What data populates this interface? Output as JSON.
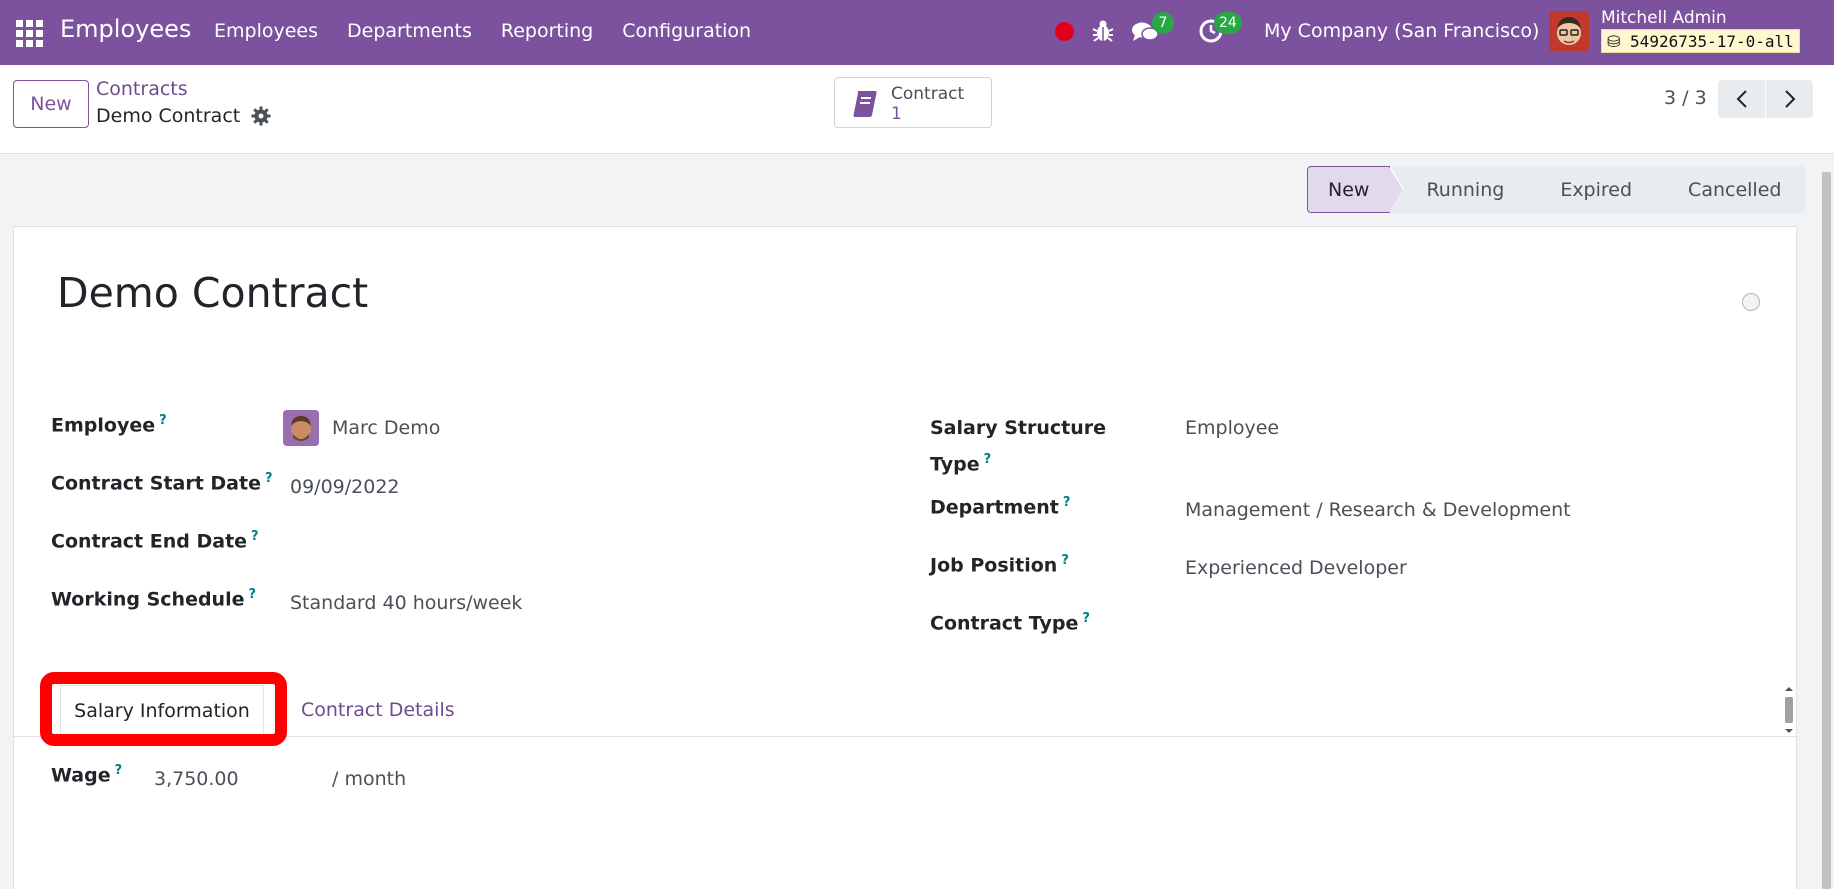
{
  "navbar": {
    "app_title": "Employees",
    "menu": [
      "Employees",
      "Departments",
      "Reporting",
      "Configuration"
    ],
    "chat_count": "7",
    "activity_count": "24",
    "company": "My Company (San Francisco)",
    "user_name": "Mitchell Admin",
    "db_name": "54926735-17-0-all",
    "accent_color": "#7c529e"
  },
  "control": {
    "new_label": "New",
    "breadcrumb_parent": "Contracts",
    "breadcrumb_current": "Demo Contract",
    "smart_button_label": "Contract",
    "smart_button_count": "1",
    "pager": "3 / 3"
  },
  "status_stages": [
    "New",
    "Running",
    "Expired",
    "Cancelled"
  ],
  "status_active": "New",
  "form": {
    "title": "Demo Contract",
    "help_mark": "?",
    "left_fields": [
      {
        "label": "Employee",
        "value": "Marc Demo"
      },
      {
        "label": "Contract Start Date",
        "value": "09/09/2022"
      },
      {
        "label": "Contract End Date",
        "value": ""
      },
      {
        "label": "Working Schedule",
        "value": "Standard 40 hours/week"
      }
    ],
    "right_fields": [
      {
        "label_line1": "Salary Structure",
        "label_line2": "Type",
        "value": "Employee"
      },
      {
        "label": "Department",
        "value": "Management / Research & Development"
      },
      {
        "label": "Job Position",
        "value": "Experienced Developer"
      },
      {
        "label": "Contract Type",
        "value": ""
      }
    ],
    "tabs": [
      "Salary Information",
      "Contract Details"
    ],
    "wage_label": "Wage",
    "wage_value": "3,750.00",
    "wage_unit": "/ month"
  }
}
